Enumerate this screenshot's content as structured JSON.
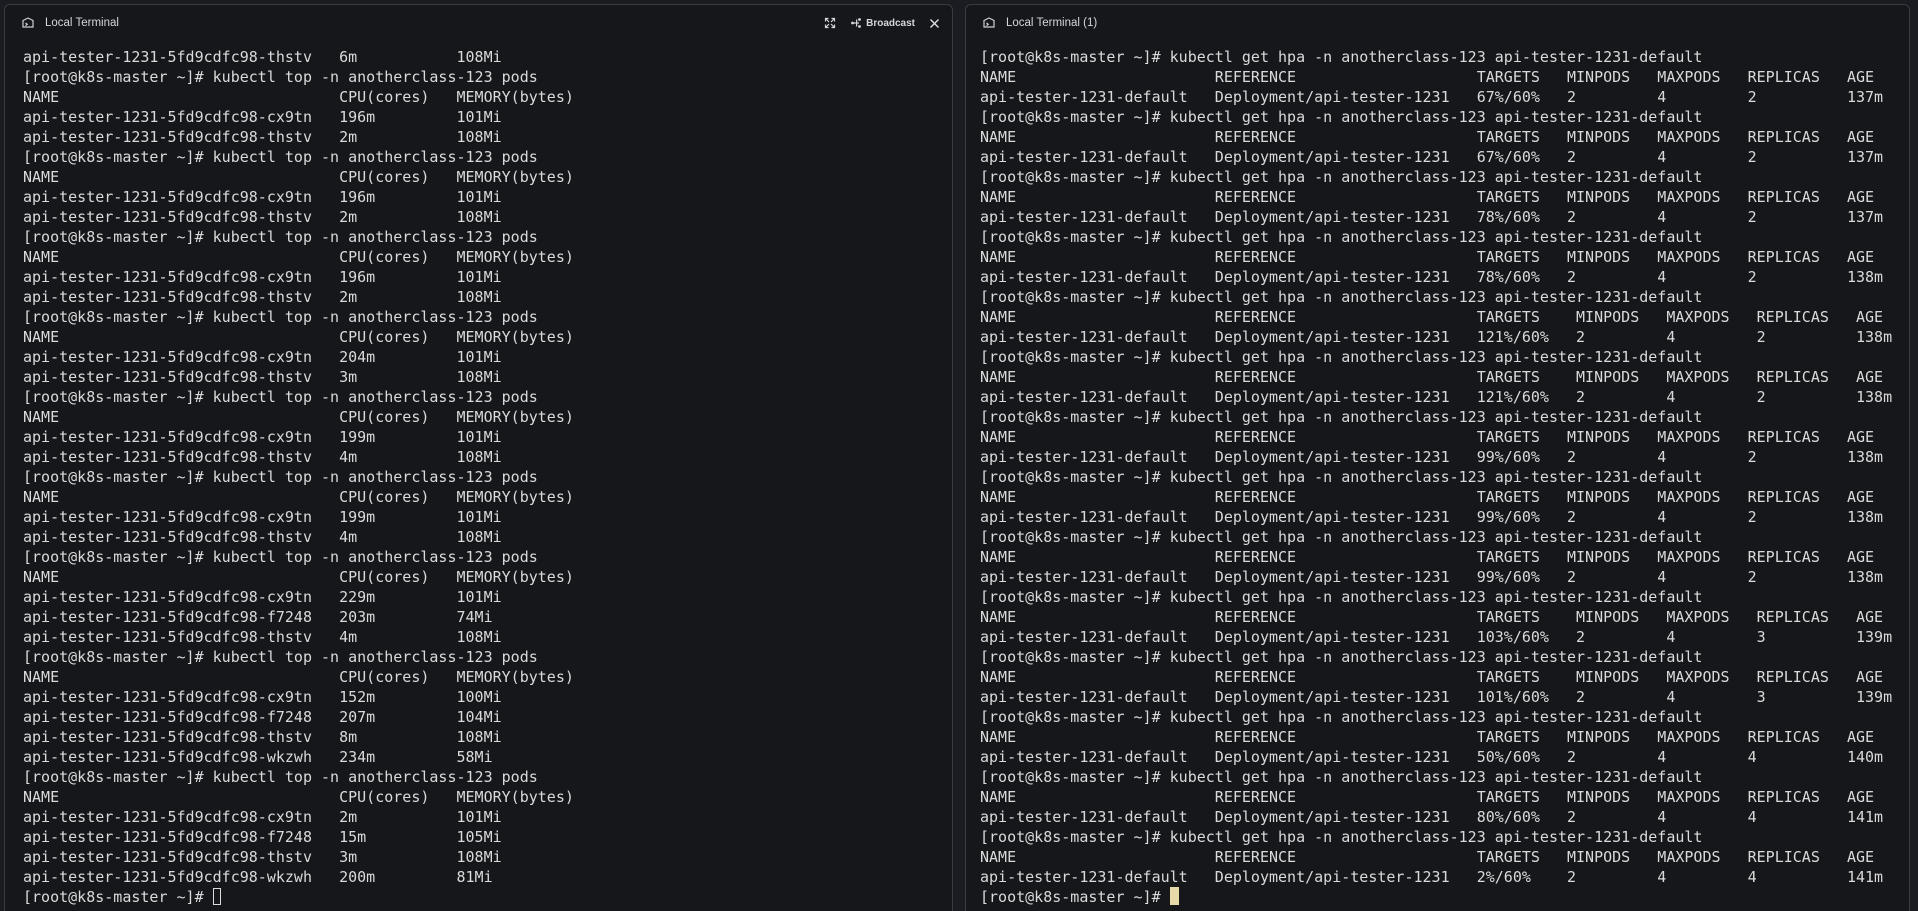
{
  "left": {
    "title": "Local Terminal",
    "broadcast_label": "Broadcast",
    "prompt": "[root@k8s-master ~]# ",
    "lines": [
      "api-tester-1231-5fd9cdfc98-thstv   6m           108Mi",
      "[root@k8s-master ~]# kubectl top -n anotherclass-123 pods",
      "NAME                               CPU(cores)   MEMORY(bytes)",
      "api-tester-1231-5fd9cdfc98-cx9tn   196m         101Mi",
      "api-tester-1231-5fd9cdfc98-thstv   2m           108Mi",
      "[root@k8s-master ~]# kubectl top -n anotherclass-123 pods",
      "NAME                               CPU(cores)   MEMORY(bytes)",
      "api-tester-1231-5fd9cdfc98-cx9tn   196m         101Mi",
      "api-tester-1231-5fd9cdfc98-thstv   2m           108Mi",
      "[root@k8s-master ~]# kubectl top -n anotherclass-123 pods",
      "NAME                               CPU(cores)   MEMORY(bytes)",
      "api-tester-1231-5fd9cdfc98-cx9tn   196m         101Mi",
      "api-tester-1231-5fd9cdfc98-thstv   2m           108Mi",
      "[root@k8s-master ~]# kubectl top -n anotherclass-123 pods",
      "NAME                               CPU(cores)   MEMORY(bytes)",
      "api-tester-1231-5fd9cdfc98-cx9tn   204m         101Mi",
      "api-tester-1231-5fd9cdfc98-thstv   3m           108Mi",
      "[root@k8s-master ~]# kubectl top -n anotherclass-123 pods",
      "NAME                               CPU(cores)   MEMORY(bytes)",
      "api-tester-1231-5fd9cdfc98-cx9tn   199m         101Mi",
      "api-tester-1231-5fd9cdfc98-thstv   4m           108Mi",
      "[root@k8s-master ~]# kubectl top -n anotherclass-123 pods",
      "NAME                               CPU(cores)   MEMORY(bytes)",
      "api-tester-1231-5fd9cdfc98-cx9tn   199m         101Mi",
      "api-tester-1231-5fd9cdfc98-thstv   4m           108Mi",
      "[root@k8s-master ~]# kubectl top -n anotherclass-123 pods",
      "NAME                               CPU(cores)   MEMORY(bytes)",
      "api-tester-1231-5fd9cdfc98-cx9tn   229m         101Mi",
      "api-tester-1231-5fd9cdfc98-f7248   203m         74Mi",
      "api-tester-1231-5fd9cdfc98-thstv   4m           108Mi",
      "[root@k8s-master ~]# kubectl top -n anotherclass-123 pods",
      "NAME                               CPU(cores)   MEMORY(bytes)",
      "api-tester-1231-5fd9cdfc98-cx9tn   152m         100Mi",
      "api-tester-1231-5fd9cdfc98-f7248   207m         104Mi",
      "api-tester-1231-5fd9cdfc98-thstv   8m           108Mi",
      "api-tester-1231-5fd9cdfc98-wkzwh   234m         58Mi",
      "[root@k8s-master ~]# kubectl top -n anotherclass-123 pods",
      "NAME                               CPU(cores)   MEMORY(bytes)",
      "api-tester-1231-5fd9cdfc98-cx9tn   2m           101Mi",
      "api-tester-1231-5fd9cdfc98-f7248   15m          105Mi",
      "api-tester-1231-5fd9cdfc98-thstv   3m           108Mi",
      "api-tester-1231-5fd9cdfc98-wkzwh   200m         81Mi"
    ]
  },
  "right": {
    "title": "Local Terminal (1)",
    "prompt": "[root@k8s-master ~]# ",
    "lines": [
      "[root@k8s-master ~]# kubectl get hpa -n anotherclass-123 api-tester-1231-default",
      "NAME                      REFERENCE                    TARGETS   MINPODS   MAXPODS   REPLICAS   AGE",
      "api-tester-1231-default   Deployment/api-tester-1231   67%/60%   2         4         2          137m",
      "[root@k8s-master ~]# kubectl get hpa -n anotherclass-123 api-tester-1231-default",
      "NAME                      REFERENCE                    TARGETS   MINPODS   MAXPODS   REPLICAS   AGE",
      "api-tester-1231-default   Deployment/api-tester-1231   67%/60%   2         4         2          137m",
      "[root@k8s-master ~]# kubectl get hpa -n anotherclass-123 api-tester-1231-default",
      "NAME                      REFERENCE                    TARGETS   MINPODS   MAXPODS   REPLICAS   AGE",
      "api-tester-1231-default   Deployment/api-tester-1231   78%/60%   2         4         2          137m",
      "[root@k8s-master ~]# kubectl get hpa -n anotherclass-123 api-tester-1231-default",
      "NAME                      REFERENCE                    TARGETS   MINPODS   MAXPODS   REPLICAS   AGE",
      "api-tester-1231-default   Deployment/api-tester-1231   78%/60%   2         4         2          138m",
      "[root@k8s-master ~]# kubectl get hpa -n anotherclass-123 api-tester-1231-default",
      "NAME                      REFERENCE                    TARGETS    MINPODS   MAXPODS   REPLICAS   AGE",
      "api-tester-1231-default   Deployment/api-tester-1231   121%/60%   2         4         2          138m",
      "[root@k8s-master ~]# kubectl get hpa -n anotherclass-123 api-tester-1231-default",
      "NAME                      REFERENCE                    TARGETS    MINPODS   MAXPODS   REPLICAS   AGE",
      "api-tester-1231-default   Deployment/api-tester-1231   121%/60%   2         4         2          138m",
      "[root@k8s-master ~]# kubectl get hpa -n anotherclass-123 api-tester-1231-default",
      "NAME                      REFERENCE                    TARGETS   MINPODS   MAXPODS   REPLICAS   AGE",
      "api-tester-1231-default   Deployment/api-tester-1231   99%/60%   2         4         2          138m",
      "[root@k8s-master ~]# kubectl get hpa -n anotherclass-123 api-tester-1231-default",
      "NAME                      REFERENCE                    TARGETS   MINPODS   MAXPODS   REPLICAS   AGE",
      "api-tester-1231-default   Deployment/api-tester-1231   99%/60%   2         4         2          138m",
      "[root@k8s-master ~]# kubectl get hpa -n anotherclass-123 api-tester-1231-default",
      "NAME                      REFERENCE                    TARGETS   MINPODS   MAXPODS   REPLICAS   AGE",
      "api-tester-1231-default   Deployment/api-tester-1231   99%/60%   2         4         2          138m",
      "[root@k8s-master ~]# kubectl get hpa -n anotherclass-123 api-tester-1231-default",
      "NAME                      REFERENCE                    TARGETS    MINPODS   MAXPODS   REPLICAS   AGE",
      "api-tester-1231-default   Deployment/api-tester-1231   103%/60%   2         4         3          139m",
      "[root@k8s-master ~]# kubectl get hpa -n anotherclass-123 api-tester-1231-default",
      "NAME                      REFERENCE                    TARGETS    MINPODS   MAXPODS   REPLICAS   AGE",
      "api-tester-1231-default   Deployment/api-tester-1231   101%/60%   2         4         3          139m",
      "[root@k8s-master ~]# kubectl get hpa -n anotherclass-123 api-tester-1231-default",
      "NAME                      REFERENCE                    TARGETS   MINPODS   MAXPODS   REPLICAS   AGE",
      "api-tester-1231-default   Deployment/api-tester-1231   50%/60%   2         4         4          140m",
      "[root@k8s-master ~]# kubectl get hpa -n anotherclass-123 api-tester-1231-default",
      "NAME                      REFERENCE                    TARGETS   MINPODS   MAXPODS   REPLICAS   AGE",
      "api-tester-1231-default   Deployment/api-tester-1231   80%/60%   2         4         4          141m",
      "[root@k8s-master ~]# kubectl get hpa -n anotherclass-123 api-tester-1231-default",
      "NAME                      REFERENCE                    TARGETS   MINPODS   MAXPODS   REPLICAS   AGE",
      "api-tester-1231-default   Deployment/api-tester-1231   2%/60%    2         4         4          141m"
    ]
  }
}
